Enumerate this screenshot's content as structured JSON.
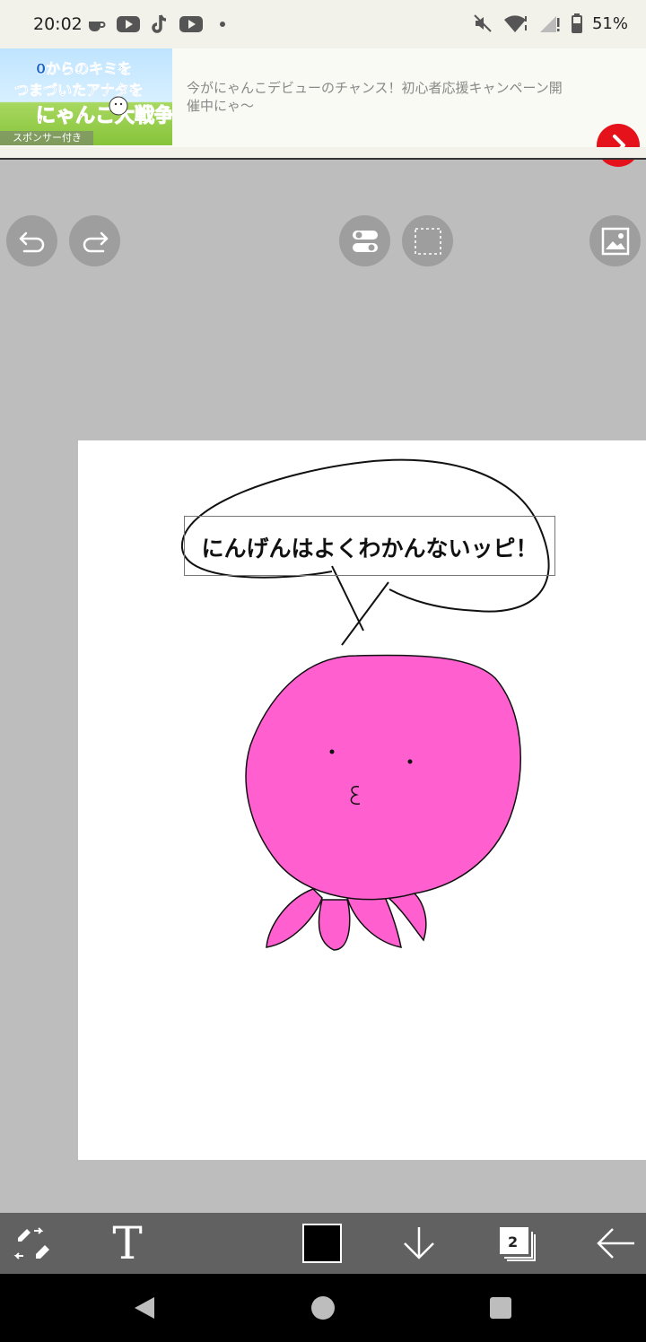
{
  "status_bar": {
    "time": "20:02",
    "left_icons": [
      "coffee-icon",
      "youtube-icon",
      "tiktok-icon",
      "youtube-icon",
      "dot-icon"
    ],
    "right_icons": [
      "mute-icon",
      "wifi-icon",
      "signal-icon",
      "battery-icon"
    ],
    "battery": "51%"
  },
  "ad": {
    "image_title_lines": [
      "0からのキミを",
      "つまづいたアナタを",
      "にゃんこ大戦争"
    ],
    "sponsor_label": "スポンサー付き",
    "text": "今がにゃんこデビューのチャンス！初心者応援キャンペーン開催中にゃ〜",
    "accent_color": "#e5121b"
  },
  "top_toolbar": {
    "buttons": [
      "undo-icon",
      "redo-icon",
      "toggle-icon",
      "selection-icon",
      "image-icon"
    ],
    "button_color": "#9e9e9e"
  },
  "canvas": {
    "textbox_text": "にんげんはよくわかんないッピ！",
    "character_color": "#ff5fcf"
  },
  "bottom_toolbar": {
    "text_tool_label": "T",
    "current_color": "#000000",
    "layer_count": "2",
    "icons": [
      "pen-eraser-swap-icon",
      "text-tool-icon",
      "color-swatch",
      "down-arrow-icon",
      "layers-icon",
      "back-arrow-icon"
    ]
  },
  "nav_bar": {
    "buttons": [
      "back-triangle-icon",
      "home-circle-icon",
      "recents-square-icon"
    ]
  }
}
